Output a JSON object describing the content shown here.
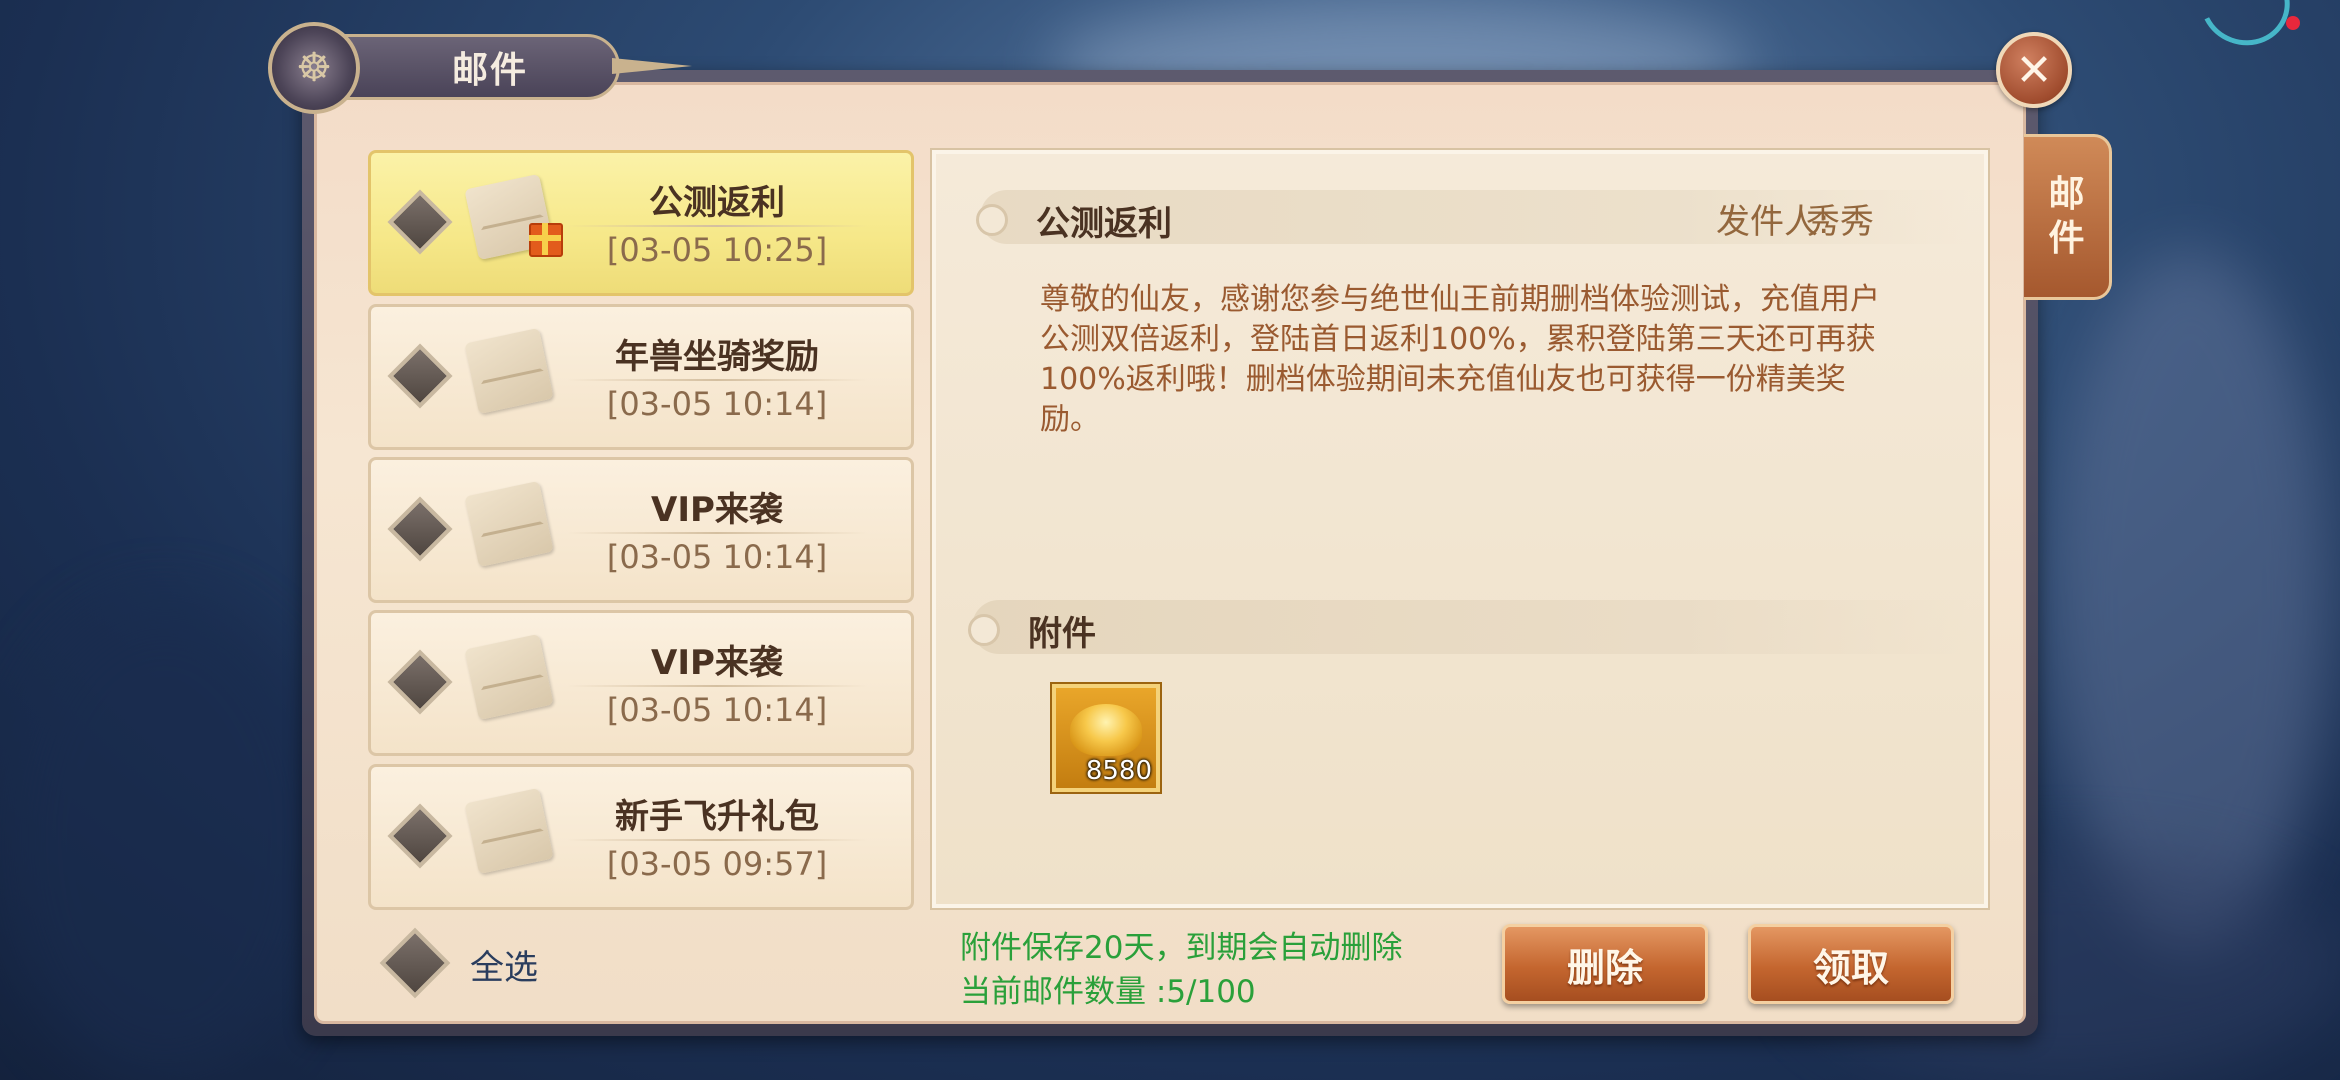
{
  "window": {
    "title": "邮件",
    "side_tab": [
      "邮",
      "件"
    ],
    "close_icon": "✕"
  },
  "mails": [
    {
      "title": "公测返利",
      "date": "[03-05  10:25]",
      "selected": true,
      "has_gift": true
    },
    {
      "title": "年兽坐骑奖励",
      "date": "[03-05  10:14]",
      "selected": false,
      "has_gift": false
    },
    {
      "title": "VIP来袭",
      "date": "[03-05  10:14]",
      "selected": false,
      "has_gift": false
    },
    {
      "title": "VIP来袭",
      "date": "[03-05  10:14]",
      "selected": false,
      "has_gift": false
    },
    {
      "title": "新手飞升礼包",
      "date": "[03-05  09:57]",
      "selected": false,
      "has_gift": false
    }
  ],
  "detail": {
    "subject": "公测返利",
    "sender_label": "发件人:",
    "sender_name": "秀秀",
    "body": "尊敬的仙友，感谢您参与绝世仙王前期删档体验测试，充值用户公测双倍返利，登陆首日返利100%，累积登陆第三天还可再获100%返利哦！删档体验期间未充值仙友也可获得一份精美奖励。",
    "attachment_label": "附件",
    "attachment": {
      "icon": "gold-ingot-icon",
      "count": "8580"
    }
  },
  "footer": {
    "select_all": "全选",
    "notice": "附件保存20天，到期会自动删除",
    "mail_count_label": "当前邮件数量 :",
    "mail_count": "5/100",
    "delete_button": "删除",
    "claim_button": "领取"
  },
  "colors": {
    "accent_orange": "#c4662f",
    "selected_yellow": "#f6e889",
    "notice_green": "#2aa03a",
    "body_text": "#9a5a30"
  }
}
